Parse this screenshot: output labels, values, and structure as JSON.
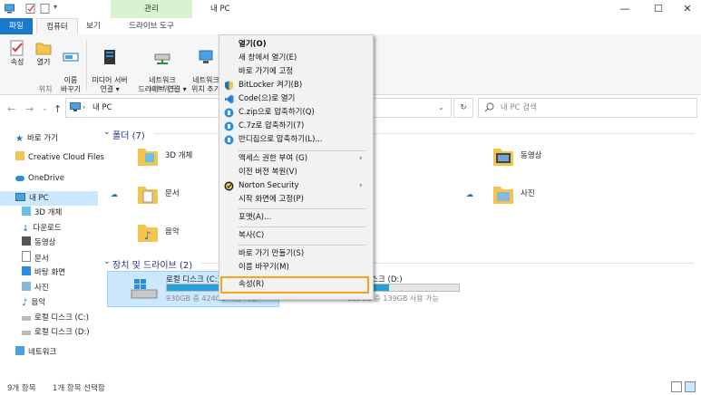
{
  "window": {
    "title": "내 PC",
    "context_tab": "관리",
    "minimize_icon": "minimize-icon",
    "maximize_icon": "maximize-icon",
    "close_icon": "close-icon"
  },
  "ribbon_tabs": [
    {
      "label": "파일"
    },
    {
      "label": "컴퓨터"
    },
    {
      "label": "보기"
    },
    {
      "label": "드라이브 도구"
    }
  ],
  "ribbon": {
    "buttons": [
      {
        "label": "속성"
      },
      {
        "label": "열기"
      },
      {
        "label": "이름\n바꾸기"
      },
      {
        "label": "미디어 서버\n연결 ▾"
      },
      {
        "label": "네트워크\n드라이브 연결 ▾"
      },
      {
        "label": "네트워크\n위치 추가"
      }
    ],
    "groups": [
      {
        "label": "위치"
      },
      {
        "label": "네트워크"
      }
    ]
  },
  "address": {
    "path": "내 PC",
    "search_placeholder": "내 PC 검색"
  },
  "nav_pane": [
    {
      "label": "바로 가기",
      "icon": "star-icon"
    },
    {
      "label": "Creative Cloud Files",
      "icon": "creative-cloud-icon"
    },
    {
      "label": "OneDrive",
      "icon": "onedrive-icon"
    },
    {
      "label": "내 PC",
      "icon": "pc-icon"
    },
    {
      "label": "3D 개체",
      "icon": "3d-objects-icon"
    },
    {
      "label": "다운로드",
      "icon": "download-icon"
    },
    {
      "label": "동영상",
      "icon": "video-icon"
    },
    {
      "label": "문서",
      "icon": "document-icon"
    },
    {
      "label": "바탕 화면",
      "icon": "desktop-icon"
    },
    {
      "label": "사진",
      "icon": "picture-icon"
    },
    {
      "label": "음악",
      "icon": "music-icon"
    },
    {
      "label": "로컬 디스크 (C:)",
      "icon": "drive-icon"
    },
    {
      "label": "로컬 디스크 (D:)",
      "icon": "drive-icon"
    },
    {
      "label": "네트워크",
      "icon": "network-icon"
    }
  ],
  "folders": {
    "header": "폴더 (7)",
    "items": [
      {
        "label": "3D 개체"
      },
      {
        "label": "동영상"
      },
      {
        "label": "문서"
      },
      {
        "label": "사진"
      },
      {
        "label": "음악"
      }
    ]
  },
  "drives": {
    "header": "장치 및 드라이브 (2)",
    "items": [
      {
        "label": "로컬 디스크 (C:)",
        "sub": "930GB 중 424GB 사용 가능",
        "used_fraction": 0.54
      },
      {
        "label": "로컬 디스크 (D:)",
        "sub": "222GB 중 139GB 사용 가능",
        "used_fraction": 0.37
      }
    ]
  },
  "status": {
    "count": "9개 항목",
    "selected": "1개 항목 선택함"
  },
  "context_menu": {
    "items": [
      {
        "label": "열기(O)"
      },
      {
        "label": "새 창에서 열기(E)"
      },
      {
        "label": "바로 가기에 고정"
      },
      {
        "label": "BitLocker 켜기(B)"
      },
      {
        "label": "Code(으)로 열기"
      },
      {
        "label": "C.zip으로 압축하기(Q)"
      },
      {
        "label": "C.7z로 압축하기(7)"
      },
      {
        "label": "반디집으로 압축하기(L)..."
      },
      {
        "label": "액세스 권한 부여 (G)"
      },
      {
        "label": "이전 버전 복원(V)"
      },
      {
        "label": "Norton Security"
      },
      {
        "label": "시작 화면에 고정(P)"
      },
      {
        "label": "포맷(A)..."
      },
      {
        "label": "복사(C)"
      },
      {
        "label": "바로 가기 만들기(S)"
      },
      {
        "label": "이름 바꾸기(M)"
      },
      {
        "label": "속성(R)"
      }
    ],
    "highlight_color": "#f7a61a"
  },
  "colors": {
    "accent": "#1979ca",
    "selection": "#cce8ff",
    "drive_bar": "#26a0da"
  }
}
